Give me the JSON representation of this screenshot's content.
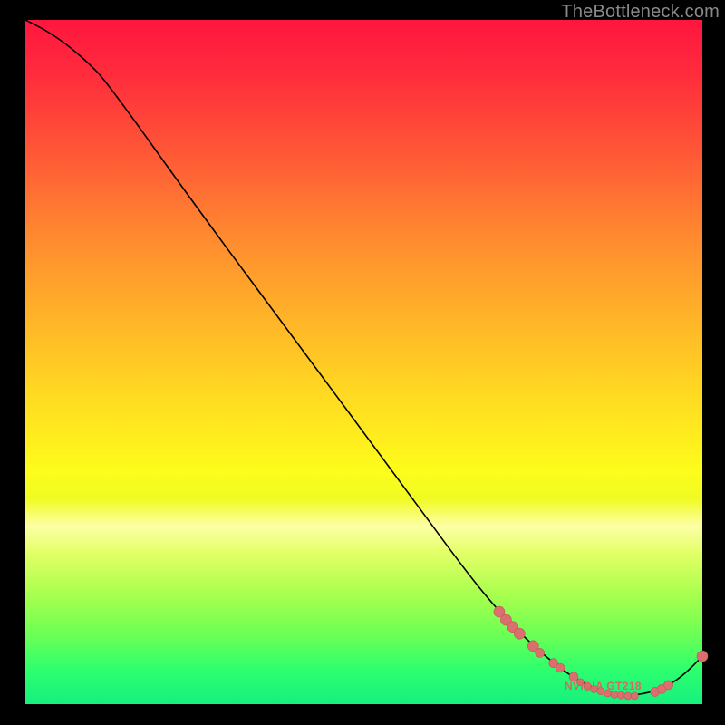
{
  "watermark": "TheBottleneck.com",
  "point_label": "NVIDIA GT218",
  "colors": {
    "curve": "#000000",
    "marker_fill": "#db6e6e",
    "marker_stroke": "#c45454",
    "label": "#d46a61"
  },
  "chart_data": {
    "type": "line",
    "title": "",
    "xlabel": "",
    "ylabel": "",
    "xlim": [
      0,
      100
    ],
    "ylim": [
      0,
      100
    ],
    "curve": [
      {
        "x": 0.0,
        "y": 100.0
      },
      {
        "x": 3.0,
        "y": 98.5
      },
      {
        "x": 6.0,
        "y": 96.5
      },
      {
        "x": 9.0,
        "y": 94.0
      },
      {
        "x": 12.0,
        "y": 91.0
      },
      {
        "x": 25.0,
        "y": 73.0
      },
      {
        "x": 40.0,
        "y": 53.0
      },
      {
        "x": 55.0,
        "y": 33.0
      },
      {
        "x": 65.0,
        "y": 19.5
      },
      {
        "x": 70.0,
        "y": 13.5
      },
      {
        "x": 74.0,
        "y": 9.5
      },
      {
        "x": 78.0,
        "y": 6.0
      },
      {
        "x": 82.0,
        "y": 3.2
      },
      {
        "x": 86.0,
        "y": 1.6
      },
      {
        "x": 90.0,
        "y": 1.2
      },
      {
        "x": 94.0,
        "y": 2.2
      },
      {
        "x": 97.0,
        "y": 4.0
      },
      {
        "x": 100.0,
        "y": 7.0
      }
    ],
    "markers": [
      {
        "x": 70.0,
        "y": 13.5,
        "r": 6
      },
      {
        "x": 71.0,
        "y": 12.3,
        "r": 6
      },
      {
        "x": 72.0,
        "y": 11.3,
        "r": 6
      },
      {
        "x": 73.0,
        "y": 10.3,
        "r": 6
      },
      {
        "x": 75.0,
        "y": 8.5,
        "r": 6
      },
      {
        "x": 76.0,
        "y": 7.5,
        "r": 5
      },
      {
        "x": 78.0,
        "y": 6.0,
        "r": 5
      },
      {
        "x": 79.0,
        "y": 5.3,
        "r": 5
      },
      {
        "x": 81.0,
        "y": 4.0,
        "r": 5
      },
      {
        "x": 82.0,
        "y": 3.2,
        "r": 4
      },
      {
        "x": 83.0,
        "y": 2.6,
        "r": 4
      },
      {
        "x": 84.0,
        "y": 2.2,
        "r": 4
      },
      {
        "x": 85.0,
        "y": 1.9,
        "r": 4
      },
      {
        "x": 86.0,
        "y": 1.6,
        "r": 4
      },
      {
        "x": 87.0,
        "y": 1.4,
        "r": 4
      },
      {
        "x": 88.0,
        "y": 1.3,
        "r": 4
      },
      {
        "x": 89.0,
        "y": 1.2,
        "r": 4
      },
      {
        "x": 90.0,
        "y": 1.2,
        "r": 4
      },
      {
        "x": 93.0,
        "y": 1.8,
        "r": 5
      },
      {
        "x": 94.0,
        "y": 2.2,
        "r": 5
      },
      {
        "x": 95.0,
        "y": 2.8,
        "r": 5
      },
      {
        "x": 100.0,
        "y": 7.0,
        "r": 6
      }
    ],
    "label_anchor": {
      "x": 85.0,
      "y": 2.5
    }
  }
}
